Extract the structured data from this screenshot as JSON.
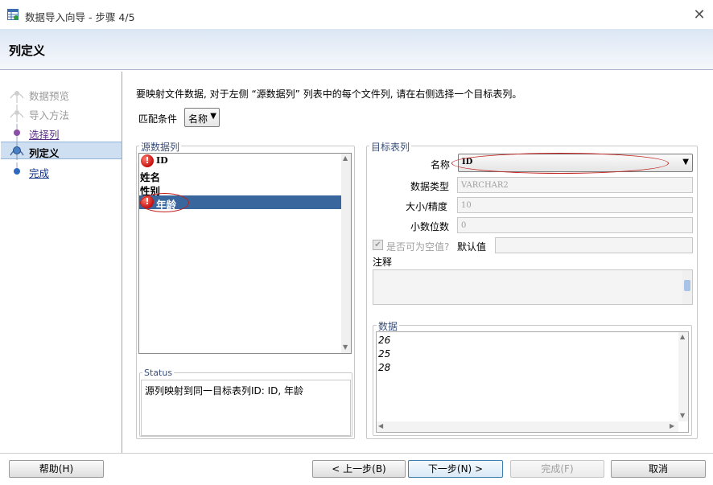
{
  "window": {
    "title": "数据导入向导 - 步骤 4/5",
    "icon": "table-import-icon",
    "close_glyph": "✕"
  },
  "header": {
    "title": "列定义"
  },
  "nav": {
    "items": [
      {
        "label": "数据预览",
        "state": "completed-dim"
      },
      {
        "label": "导入方法",
        "state": "completed-dim"
      },
      {
        "label": "选择列",
        "state": "link"
      },
      {
        "label": "列定义",
        "state": "active"
      },
      {
        "label": "完成",
        "state": "link"
      }
    ]
  },
  "instruction": "要映射文件数据, 对于左侧 “源数据列” 列表中的每个文件列, 请在右侧选择一个目标表列。",
  "match": {
    "label": "匹配条件",
    "value": "名称"
  },
  "source": {
    "group_title": "源数据列",
    "rows": [
      {
        "text": "ID",
        "error": true,
        "selected": false
      },
      {
        "text": "姓名",
        "error": false,
        "selected": false
      },
      {
        "text": "性别",
        "error": false,
        "selected": false
      },
      {
        "text": "年龄",
        "error": true,
        "selected": true
      }
    ],
    "error_glyph": "!"
  },
  "status": {
    "title": "Status",
    "text": "源列映射到同一目标表列ID: ID, 年龄"
  },
  "target": {
    "group_title": "目标表列",
    "name_label": "名称",
    "name_value": "ID",
    "datatype_label": "数据类型",
    "datatype_value": "VARCHAR2",
    "size_label": "大小/精度",
    "size_value": "10",
    "scale_label": "小数位数",
    "scale_value": "0",
    "nullable_label": "是否可为空值?",
    "nullable_checked": true,
    "default_label": "默认值",
    "default_value": "",
    "comment_label": "注释",
    "data_title": "数据",
    "data_rows": [
      "26",
      "25",
      "28"
    ]
  },
  "buttons": {
    "help": "帮助(H)",
    "back": "< 上一步(B)",
    "next": "下一步(N) >",
    "finish": "完成(F)",
    "cancel": "取消"
  },
  "colors": {
    "accent": "#39669c",
    "annotation": "#c0201c",
    "error": "#c40f0f"
  }
}
